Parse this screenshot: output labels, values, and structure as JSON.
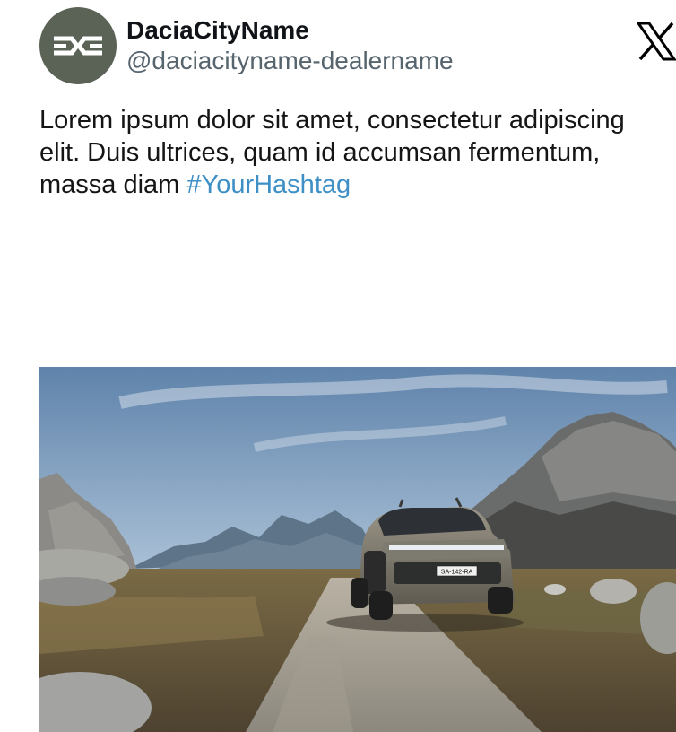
{
  "tweet": {
    "account": {
      "display_name": "DaciaCityName",
      "handle": "@daciacityname-dealername"
    },
    "text": {
      "line_1": "Lorem ipsum dolor sit amet, consectetur adipiscing",
      "line_2": "elit. Duis ultrices, quam id accumsan fermentum,",
      "line_3_prefix": "massa diam ",
      "hashtag": "#YourHashtag"
    },
    "media": {
      "plate": "SA-142-RA"
    },
    "icons": {
      "avatar": "dacia-logo-icon",
      "platform": "x-logo-icon"
    }
  },
  "colors": {
    "avatar_bg": "#5a6356",
    "hashtag": "#3d8fc6",
    "handle": "#56646e"
  }
}
